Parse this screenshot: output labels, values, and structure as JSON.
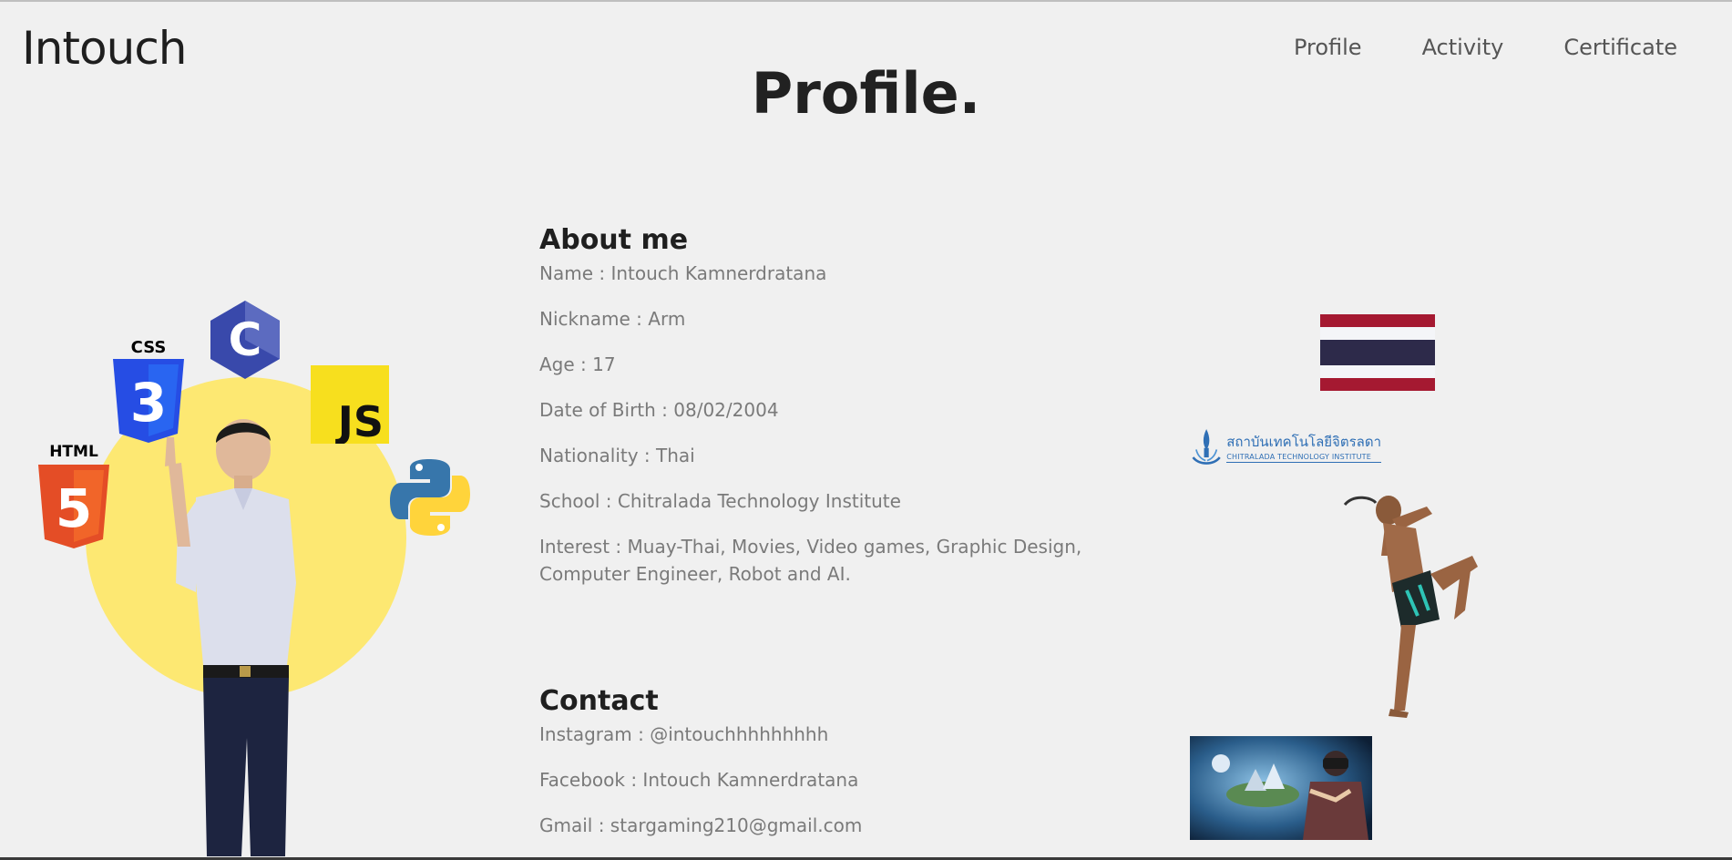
{
  "header": {
    "logo": "Intouch",
    "nav": [
      "Profile",
      "Activity",
      "Certificate"
    ]
  },
  "page_title": "Profile.",
  "about": {
    "heading": "About me",
    "lines": [
      "Name : Intouch Kamnerdratana",
      "Nickname : Arm",
      "Age : 17",
      "Date of Birth : 08/02/2004",
      "Nationality : Thai",
      "School : Chitralada Technology Institute",
      "Interest : Muay-Thai, Movies, Video games, Graphic Design, Computer Engineer, Robot and AI."
    ]
  },
  "contact": {
    "heading": "Contact",
    "lines": [
      "Instagram : @intouchhhhhhhhh",
      "Facebook : Intouch Kamnerdratana",
      "Gmail : stargaming210@gmail.com"
    ]
  },
  "badges": {
    "css": "CSS",
    "html": "HTML",
    "js": "JS",
    "c": "C",
    "html_digit": "5",
    "css_digit": "3"
  },
  "school_logo": {
    "thai": "สถาบันเทคโนโลยีจิตรลดา",
    "english": "CHITRALADA TECHNOLOGY INSTITUTE"
  },
  "colors": {
    "background": "#f0f0f0",
    "sun": "#fde872",
    "thai_red": "#a51931",
    "thai_blue": "#2d2a4a",
    "html_orange": "#e44d26",
    "css_blue": "#264de4",
    "js_yellow": "#f7df1e",
    "c_blue": "#3949ab"
  }
}
